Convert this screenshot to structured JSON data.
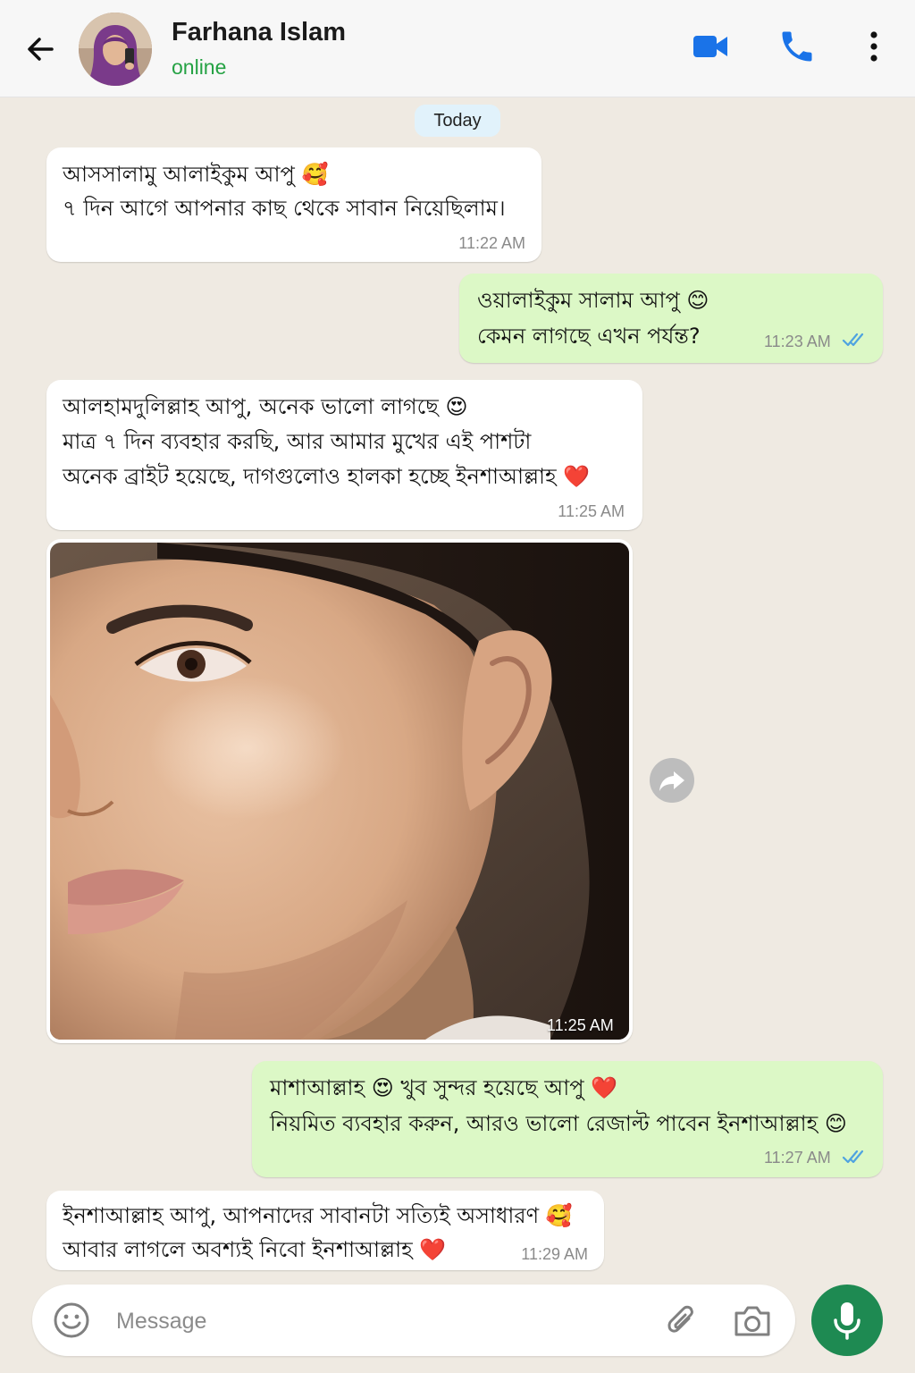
{
  "header": {
    "contact_name": "Farhana Islam",
    "status": "online",
    "status_color": "#25a244",
    "icon_color": "#1a73e8",
    "icons": [
      "back-arrow-icon",
      "video-call-icon",
      "phone-icon",
      "more-vert-icon"
    ]
  },
  "date_chip": "Today",
  "messages": [
    {
      "direction": "in",
      "lines": [
        "আসসালামু আলাইকুম আপু 🥰",
        "৭ দিন আগে আপনার কাছ থেকে সাবান নিয়েছিলাম।"
      ],
      "time": "11:22 AM"
    },
    {
      "direction": "out",
      "lines": [
        "ওয়ালাইকুম সালাম আপু 😊",
        "কেমন লাগছে এখন পর্যন্ত?"
      ],
      "time": "11:23 AM",
      "status": "read"
    },
    {
      "direction": "in",
      "lines": [
        "আলহামদুলিল্লাহ আপু, অনেক ভালো লাগছে 😍",
        "মাত্র ৭ দিন ব্যবহার করছি, আর আমার মুখের এই পাশটা",
        "অনেক ব্রাইট হয়েছে, দাগগুলোও হালকা হচ্ছে ইনশাআল্লাহ ❤️"
      ],
      "time": "11:25 AM"
    },
    {
      "direction": "in",
      "type": "image",
      "time": "11:25 AM"
    },
    {
      "direction": "out",
      "lines": [
        "মাশাআল্লাহ 😍 খুব সুন্দর হয়েছে আপু ❤️",
        "নিয়মিত ব্যবহার করুন, আরও ভালো রেজাল্ট পাবেন ইনশাআল্লাহ 😊"
      ],
      "time": "11:27 AM",
      "status": "read"
    },
    {
      "direction": "in",
      "lines": [
        "ইনশাআল্লাহ আপু, আপনাদের সাবানটা সত্যিই অসাধারণ 🥰",
        "আবার লাগলে অবশ্যই নিবো ইনশাআল্লাহ ❤️"
      ],
      "time": "11:29 AM"
    }
  ],
  "composer": {
    "placeholder": "Message",
    "icons": [
      "emoji-icon",
      "attach-icon",
      "camera-icon",
      "mic-icon"
    ]
  },
  "colors": {
    "background": "#efeae2",
    "incoming_bubble": "#ffffff",
    "outgoing_bubble": "#dcf8c6",
    "read_ticks": "#4fa3e0",
    "mic_button": "#1e8a52"
  }
}
